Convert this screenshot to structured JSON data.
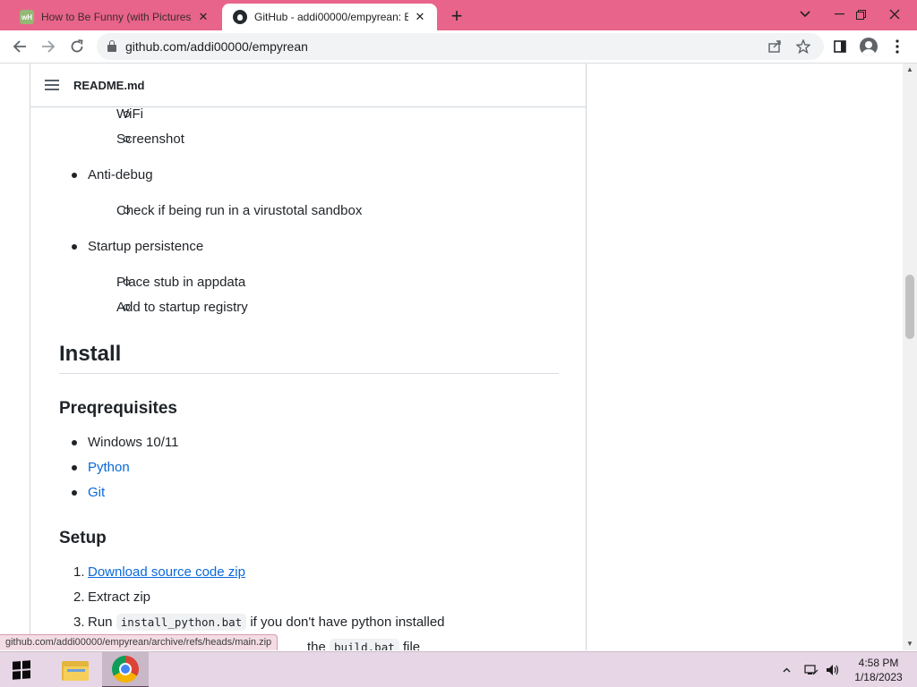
{
  "browser": {
    "tabs": [
      {
        "title": "How to Be Funny (with Pictures)",
        "icon": "wikihow-icon",
        "active": false
      },
      {
        "title": "GitHub - addi00000/empyrean: E",
        "icon": "github-icon",
        "active": true
      }
    ],
    "url": "github.com/addi00000/empyrean"
  },
  "readme": {
    "filename": "README.md",
    "items": {
      "wifi": "WiFi",
      "screenshot": "Screenshot",
      "anti_debug": "Anti-debug",
      "virustotal": "Check if being run in a virustotal sandbox",
      "startup": "Startup persistence",
      "place_stub": "Place stub in appdata",
      "add_registry": "Add to startup registry"
    },
    "install_heading": "Install",
    "prereq_heading": "Preqrequisites",
    "prereqs": [
      "Windows 10/11",
      "Python",
      "Git"
    ],
    "setup_heading": "Setup",
    "setup_steps": {
      "n1": "1.",
      "s1": "Download source code zip",
      "n2": "2.",
      "s2": "Extract zip",
      "n3": "3.",
      "s3_prefix": "Run",
      "s3_code": "install_python.bat",
      "s3_suffix": "if you don't have python installed",
      "s4_partial": "the",
      "s4_code": "build.bat",
      "s4_suffix": "file"
    }
  },
  "status_bar": {
    "hover_url": "github.com/addi00000/empyrean/archive/refs/heads/main.zip"
  },
  "taskbar": {
    "time": "4:58 PM",
    "date": "1/18/2023"
  },
  "colors": {
    "tabstrip": "#e8648a",
    "link": "#0969da",
    "taskbar": "#e7d6e6"
  }
}
